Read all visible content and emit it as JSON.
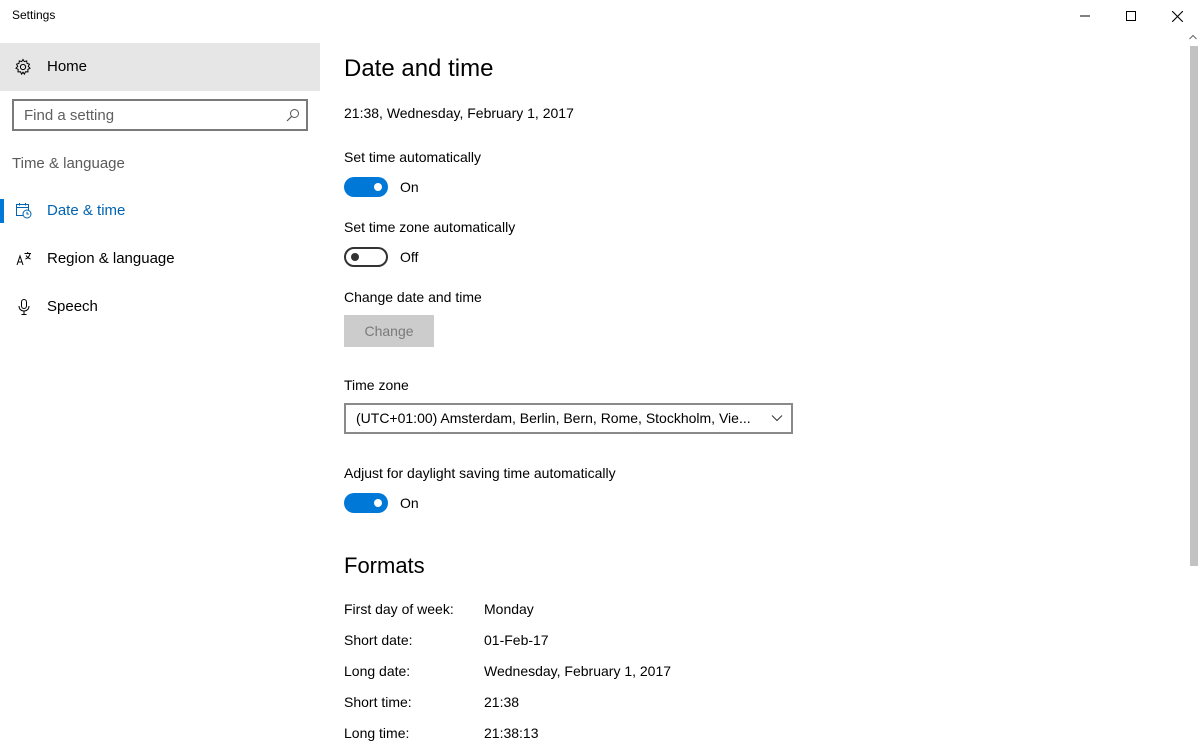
{
  "window": {
    "title": "Settings"
  },
  "sidebar": {
    "home_label": "Home",
    "search_placeholder": "Find a setting",
    "section_label": "Time & language",
    "items": [
      {
        "label": "Date & time",
        "icon": "calendar-clock-icon",
        "active": true
      },
      {
        "label": "Region & language",
        "icon": "language-icon",
        "active": false
      },
      {
        "label": "Speech",
        "icon": "microphone-icon",
        "active": false
      }
    ]
  },
  "main": {
    "title": "Date and time",
    "current_datetime": "21:38, Wednesday, February 1, 2017",
    "set_time_auto": {
      "label": "Set time automatically",
      "state": "On"
    },
    "set_timezone_auto": {
      "label": "Set time zone automatically",
      "state": "Off"
    },
    "change_datetime": {
      "label": "Change date and time",
      "button": "Change"
    },
    "timezone": {
      "label": "Time zone",
      "value": "(UTC+01:00) Amsterdam, Berlin, Bern, Rome, Stockholm, Vie..."
    },
    "daylight": {
      "label": "Adjust for daylight saving time automatically",
      "state": "On"
    },
    "formats": {
      "title": "Formats",
      "rows": [
        {
          "key": "First day of week:",
          "value": "Monday"
        },
        {
          "key": "Short date:",
          "value": "01-Feb-17"
        },
        {
          "key": "Long date:",
          "value": "Wednesday, February 1, 2017"
        },
        {
          "key": "Short time:",
          "value": "21:38"
        },
        {
          "key": "Long time:",
          "value": "21:38:13"
        }
      ]
    }
  },
  "colors": {
    "accent": "#0078d7",
    "active_text": "#0063b1",
    "sidebar_selected_bg": "#e6e6e6"
  }
}
